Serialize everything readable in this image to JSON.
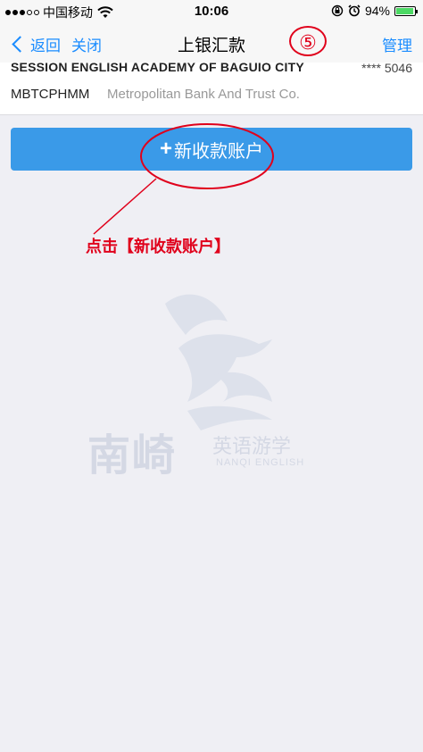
{
  "status_bar": {
    "carrier": "中国移动",
    "time": "10:06",
    "battery_percent": "94%",
    "battery_level": 0.94,
    "icons": [
      "signal-dots-icon",
      "wifi-icon",
      "lock-rotation-icon",
      "alarm-icon",
      "battery-icon"
    ]
  },
  "nav": {
    "back_label": "返回",
    "close_label": "关闭",
    "title": "上银汇款",
    "manage_label": "管理",
    "step_marker": "⑤"
  },
  "account": {
    "name": "SESSION ENGLISH ACADEMY OF BAGUIO CITY",
    "number_masked": "**** 5046",
    "swift_code": "MBTCPHMM",
    "bank_name": "Metropolitan Bank And Trust Co."
  },
  "new_payee_button": {
    "plus": "+",
    "label": "新收款账户"
  },
  "annotation": {
    "text": "点击【新收款账户】",
    "color": "#e0001b"
  },
  "watermark": {
    "text": "南崎",
    "subtext": "英语游学",
    "english": "NANQI ENGLISH"
  },
  "colors": {
    "accent": "#1a8cff",
    "button": "#3a9ae8",
    "background": "#efeff4"
  }
}
